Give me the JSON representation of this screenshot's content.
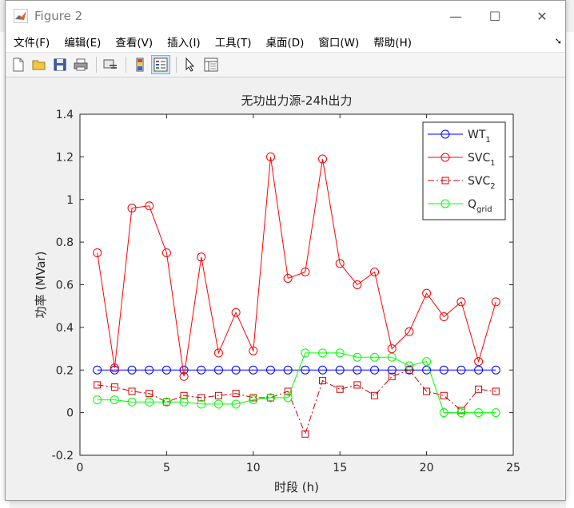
{
  "window": {
    "title": "Figure 2",
    "controls": {
      "minimize": "—",
      "maximize": "☐",
      "close": "✕"
    }
  },
  "menu": [
    "文件(F)",
    "编辑(E)",
    "查看(V)",
    "插入(I)",
    "工具(T)",
    "桌面(D)",
    "窗口(W)",
    "帮助(H)"
  ],
  "toolbar": [
    "new-figure-icon",
    "open-file-icon",
    "save-icon",
    "print-icon",
    "link-plot-icon",
    "insert-colorbar-icon",
    "insert-legend-icon",
    "edit-plot-icon",
    "property-inspector-icon"
  ],
  "chart_data": {
    "type": "line",
    "title": "无功出力源-24h出力",
    "xlabel": "时段 (h)",
    "ylabel": "功率 (MVar)",
    "xlim": [
      0,
      25
    ],
    "ylim": [
      -0.2,
      1.4
    ],
    "xticks": [
      0,
      5,
      10,
      15,
      20,
      25
    ],
    "yticks": [
      -0.2,
      0,
      0.2,
      0.4,
      0.6,
      0.8,
      1,
      1.2,
      1.4
    ],
    "ytick_labels": [
      "-0.2",
      "0",
      "0.2",
      "0.4",
      "0.6",
      "0.8",
      "1",
      "1.2",
      "1.4"
    ],
    "grid": false,
    "legend_position": "top-right",
    "x": [
      1,
      2,
      3,
      4,
      5,
      6,
      7,
      8,
      9,
      10,
      11,
      12,
      13,
      14,
      15,
      16,
      17,
      18,
      19,
      20,
      21,
      22,
      23,
      24
    ],
    "series": [
      {
        "name": "WT",
        "sub": "1",
        "color": "#0000ff",
        "marker": "circle",
        "dash": "solid",
        "values": [
          0.2,
          0.2,
          0.2,
          0.2,
          0.2,
          0.2,
          0.2,
          0.2,
          0.2,
          0.2,
          0.2,
          0.2,
          0.2,
          0.2,
          0.2,
          0.2,
          0.2,
          0.2,
          0.2,
          0.2,
          0.2,
          0.2,
          0.2,
          0.2
        ]
      },
      {
        "name": "SVC",
        "sub": "1",
        "color": "#ff0000",
        "marker": "circle",
        "dash": "solid",
        "values": [
          0.75,
          0.21,
          0.96,
          0.97,
          0.75,
          0.17,
          0.73,
          0.28,
          0.47,
          0.29,
          1.2,
          0.63,
          0.66,
          1.19,
          0.7,
          0.6,
          0.66,
          0.3,
          0.38,
          0.56,
          0.45,
          0.52,
          0.24,
          0.52
        ]
      },
      {
        "name": "SVC",
        "sub": "2",
        "color": "#d40000",
        "marker": "square",
        "dash": "dashdot",
        "values": [
          0.13,
          0.12,
          0.1,
          0.09,
          0.05,
          0.08,
          0.07,
          0.08,
          0.09,
          0.07,
          0.07,
          0.1,
          -0.1,
          0.15,
          0.11,
          0.13,
          0.08,
          0.17,
          0.2,
          0.1,
          0.08,
          0.01,
          0.11,
          0.1
        ]
      },
      {
        "name": "Q",
        "sub": "grid",
        "color": "#00ff00",
        "marker": "circle",
        "dash": "solid",
        "values": [
          0.06,
          0.06,
          0.05,
          0.05,
          0.05,
          0.05,
          0.04,
          0.04,
          0.04,
          0.06,
          0.07,
          0.07,
          0.28,
          0.28,
          0.28,
          0.26,
          0.26,
          0.26,
          0.22,
          0.24,
          0.0,
          0.0,
          0.0,
          0.0
        ]
      }
    ]
  }
}
